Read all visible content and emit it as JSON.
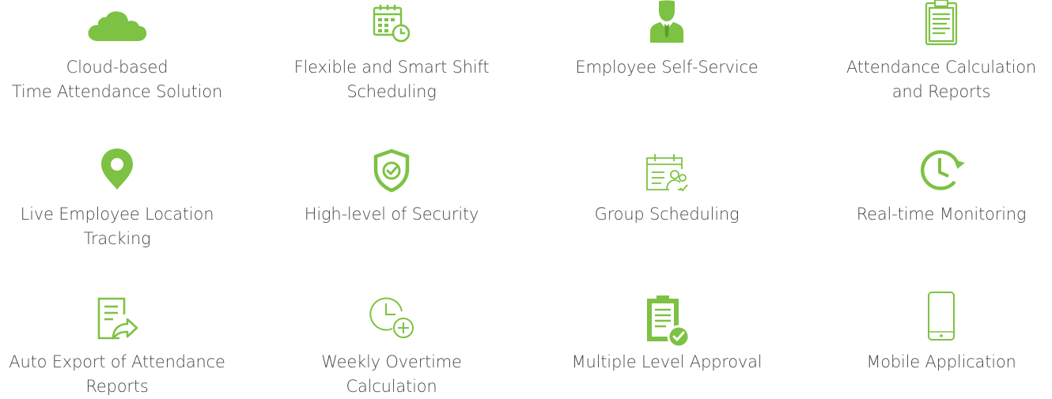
{
  "accent_color": "#7dc242",
  "features": [
    {
      "icon": "cloud-icon",
      "lines": [
        "Cloud-based",
        "Time Attendance Solution"
      ]
    },
    {
      "icon": "calendar-clock-icon",
      "lines": [
        "Flexible and Smart Shift",
        "Scheduling"
      ]
    },
    {
      "icon": "employee-icon",
      "lines": [
        "Employee Self-Service"
      ]
    },
    {
      "icon": "clipboard-icon",
      "lines": [
        "Attendance Calculation",
        "and Reports"
      ]
    },
    {
      "icon": "location-pin-icon",
      "lines": [
        "Live Employee Location",
        "Tracking"
      ]
    },
    {
      "icon": "shield-check-icon",
      "lines": [
        "High-level of Security"
      ]
    },
    {
      "icon": "calendar-group-icon",
      "lines": [
        "Group Scheduling"
      ]
    },
    {
      "icon": "clock-refresh-icon",
      "lines": [
        "Real-time Monitoring"
      ]
    },
    {
      "icon": "document-export-icon",
      "lines": [
        "Auto Export of Attendance",
        "Reports"
      ]
    },
    {
      "icon": "clock-plus-icon",
      "lines": [
        "Weekly Overtime",
        "Calculation"
      ]
    },
    {
      "icon": "clipboard-check-icon",
      "lines": [
        "Multiple Level Approval"
      ]
    },
    {
      "icon": "smartphone-icon",
      "lines": [
        "Mobile Application"
      ]
    }
  ]
}
